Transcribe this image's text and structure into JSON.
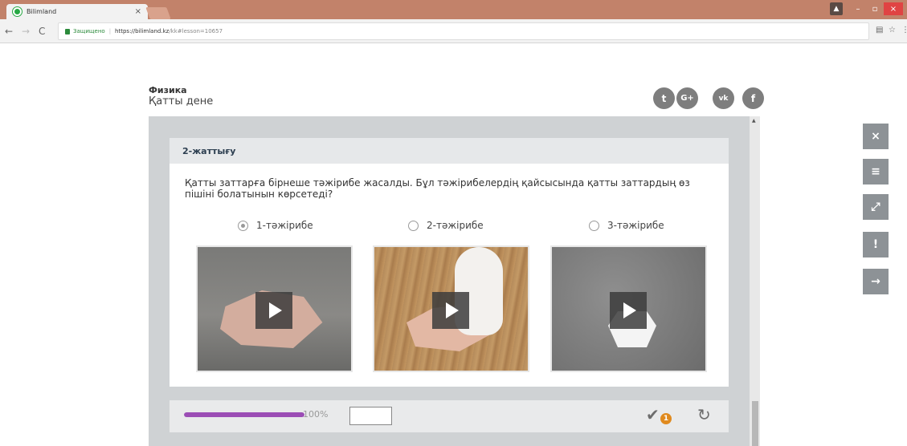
{
  "browser": {
    "tab_title": "Bilimland",
    "tab_close": "×",
    "secure_label": "Защищено",
    "url_host": "https://bilimland.kz",
    "url_path": "/kk#lesson=10657",
    "window_user": "▲",
    "window_min": "–",
    "window_max": "▫",
    "window_close": "×"
  },
  "lesson": {
    "subject": "Физика",
    "topic": "Қатты дене"
  },
  "exercise": {
    "title": "2-жаттығу",
    "question": "Қатты заттарға бірнеше тәжірибе жасалды. Бұл тәжірибелердің қайсысында қатты заттардың өз пішіні болатынын көрсетеді?",
    "options": [
      {
        "label": "1-тәжірибе",
        "checked": true
      },
      {
        "label": "2-тәжірибе",
        "checked": false
      },
      {
        "label": "3-тәжірибе",
        "checked": false
      }
    ]
  },
  "footer": {
    "progress_percent": 100,
    "progress_label": "100%",
    "attempts_badge": "1"
  },
  "social": {
    "twitter": "t",
    "googleplus": "G+",
    "vk": "vk",
    "facebook": "f"
  },
  "side_tools": {
    "close": "×",
    "menu": "≡",
    "expand": "⤢",
    "warning": "!",
    "next": "→"
  },
  "colors": {
    "progress": "#9b4db5",
    "badge": "#e08a1e",
    "tool_bg": "#8d9296"
  }
}
